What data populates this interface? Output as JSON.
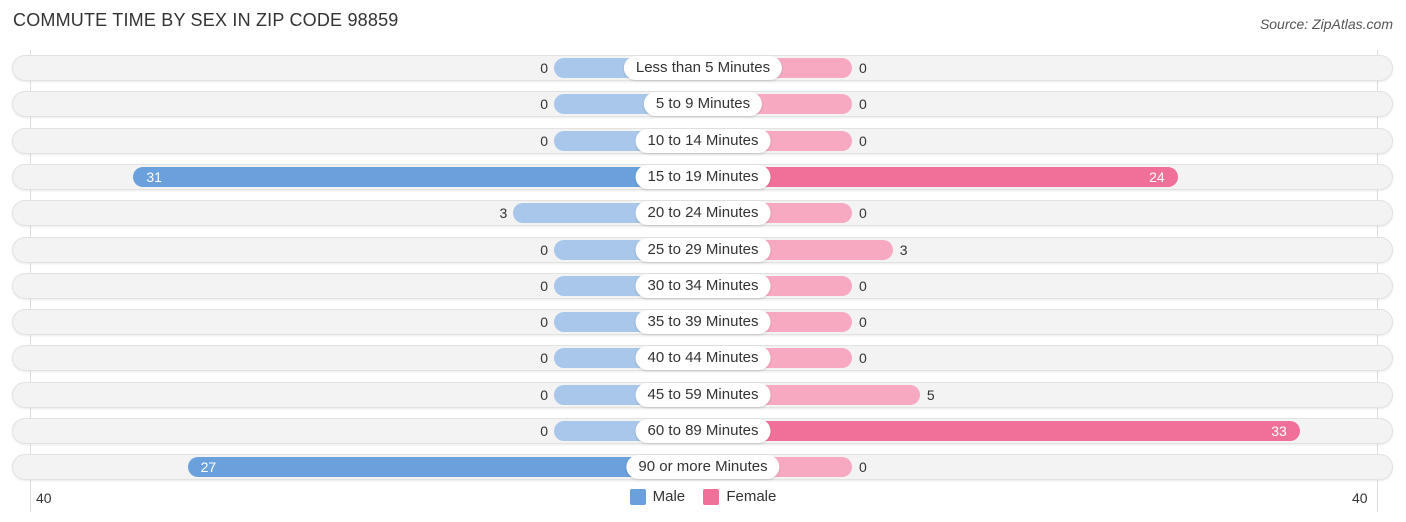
{
  "title": "COMMUTE TIME BY SEX IN ZIP CODE 98859",
  "source": "Source: ZipAtlas.com",
  "colors": {
    "male": "#6aa0dc",
    "male_light": "#a9c7ea",
    "female": "#f07099",
    "female_light": "#f6a9c1"
  },
  "chart_data": {
    "type": "bar",
    "orientation": "horizontal-diverging",
    "title": "COMMUTE TIME BY SEX IN ZIP CODE 98859",
    "categories": [
      "Less than 5 Minutes",
      "5 to 9 Minutes",
      "10 to 14 Minutes",
      "15 to 19 Minutes",
      "20 to 24 Minutes",
      "25 to 29 Minutes",
      "30 to 34 Minutes",
      "35 to 39 Minutes",
      "40 to 44 Minutes",
      "45 to 59 Minutes",
      "60 to 89 Minutes",
      "90 or more Minutes"
    ],
    "series": [
      {
        "name": "Male",
        "values": [
          0,
          0,
          0,
          31,
          3,
          0,
          0,
          0,
          0,
          0,
          0,
          27
        ]
      },
      {
        "name": "Female",
        "values": [
          0,
          0,
          0,
          24,
          0,
          3,
          0,
          0,
          0,
          5,
          33,
          0
        ]
      }
    ],
    "xlim": [
      40,
      40
    ],
    "axis_labels": {
      "left": "40",
      "right": "40"
    },
    "legend": {
      "position": "bottom-center",
      "entries": [
        "Male",
        "Female"
      ]
    }
  }
}
